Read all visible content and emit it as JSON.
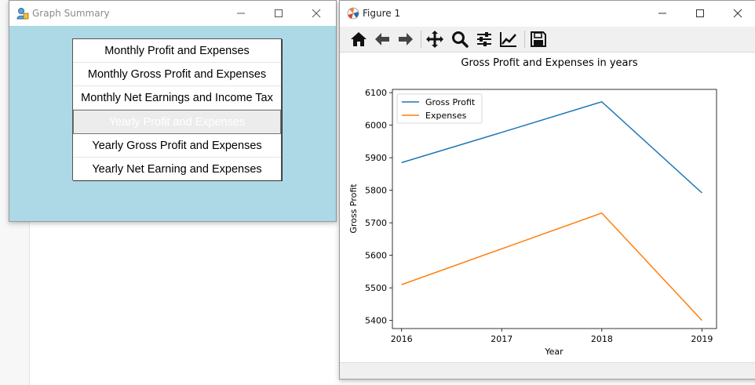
{
  "graph_summary_window": {
    "title": "Graph Summary",
    "buttons": [
      "Monthly Profit and Expenses",
      "Monthly Gross Profit and Expenses",
      "Monthly Net Earnings and Income Tax",
      "Yearly Profit and Expenses",
      "Yearly Gross Profit and Expenses",
      "Yearly Net Earning and Expenses"
    ],
    "background_color": "#add8e6"
  },
  "figure_window": {
    "title": "Figure 1",
    "toolbar_icons": [
      "home-icon",
      "back-arrow-icon",
      "forward-arrow-icon",
      "pan-icon",
      "zoom-icon",
      "subplots-config-icon",
      "edit-axis-icon",
      "save-icon"
    ]
  },
  "chart_data": {
    "type": "line",
    "title": "Gross Profit and Expenses in years",
    "xlabel": "Year",
    "ylabel": "Gross Profit",
    "x": [
      2016,
      2017,
      2018,
      2019
    ],
    "x_ticks": [
      "2016",
      "2017",
      "2018",
      "2019"
    ],
    "y_ticks": [
      "5400",
      "5500",
      "5600",
      "5700",
      "5800",
      "5900",
      "6000",
      "6100"
    ],
    "ylim": [
      5375,
      6110
    ],
    "grid": false,
    "legend_position": "top-left",
    "series": [
      {
        "name": "Gross Profit",
        "color": "#1f77b4",
        "values": [
          5885,
          5978,
          6072,
          5792
        ]
      },
      {
        "name": "Expenses",
        "color": "#ff7f0e",
        "values": [
          5510,
          5620,
          5730,
          5400
        ]
      }
    ]
  }
}
